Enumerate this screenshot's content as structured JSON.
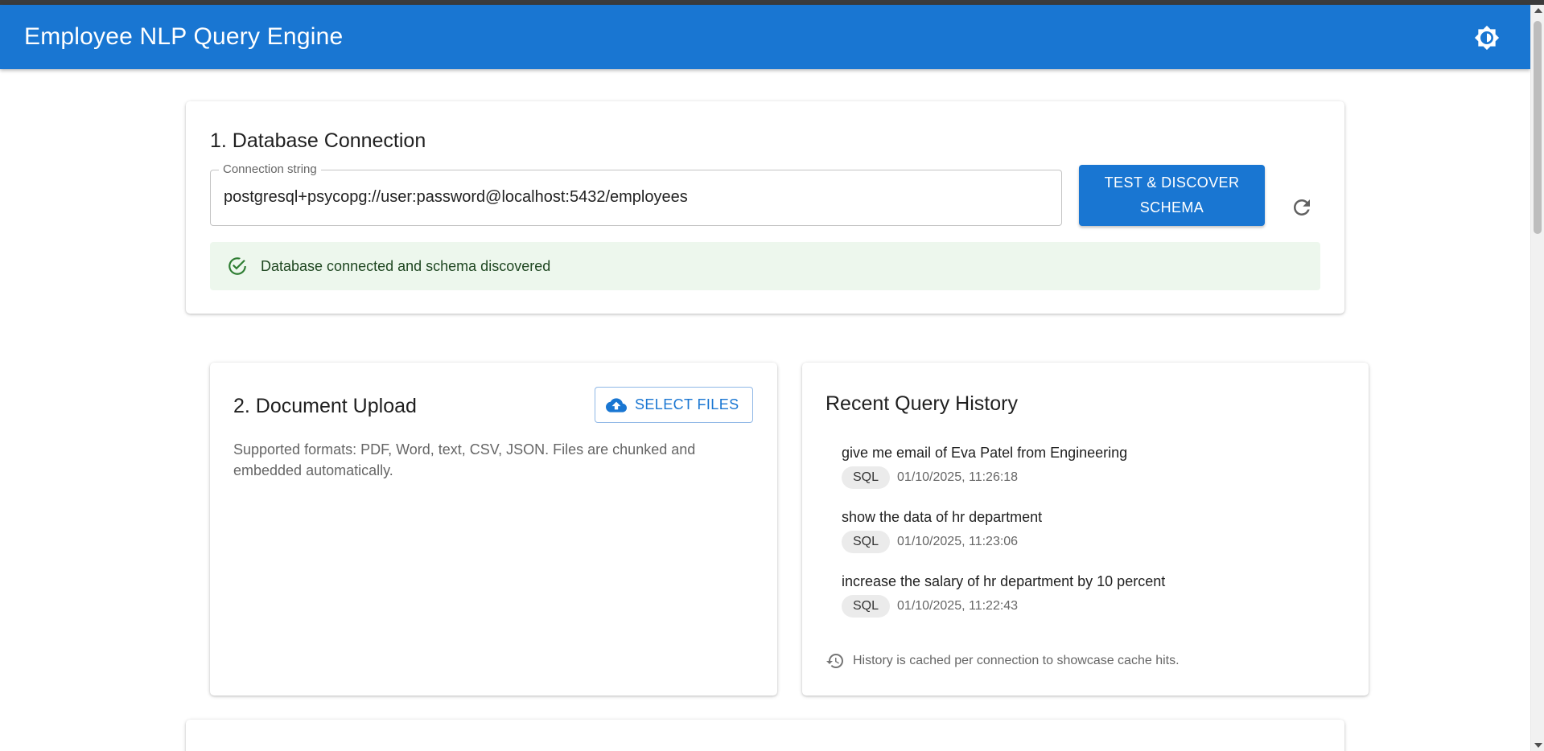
{
  "app": {
    "title": "Employee NLP Query Engine",
    "theme_icon": "brightness-icon"
  },
  "database": {
    "title": "1. Database Connection",
    "connection_label": "Connection string",
    "connection_value": "postgresql+psycopg://user:password@localhost:5432/employees",
    "test_button_line1": "TEST & DISCOVER",
    "test_button_line2": "SCHEMA",
    "refresh_icon": "refresh-icon",
    "status_text": "Database connected and schema discovered",
    "status_color": "#edf7ed"
  },
  "upload": {
    "title": "2. Document Upload",
    "select_label": "SELECT FILES",
    "description": "Supported formats: PDF, Word, text, CSV, JSON. Files are chunked and embedded automatically."
  },
  "history": {
    "title": "Recent Query History",
    "items": [
      {
        "query": "give me email of Eva Patel from Engineering",
        "type": "SQL",
        "time": "01/10/2025, 11:26:18"
      },
      {
        "query": "show the data of hr department",
        "type": "SQL",
        "time": "01/10/2025, 11:23:06"
      },
      {
        "query": "increase the salary of hr department by 10 percent",
        "type": "SQL",
        "time": "01/10/2025, 11:22:43"
      }
    ],
    "note": "History is cached per connection to showcase cache hits."
  },
  "colors": {
    "primary": "#1976d2",
    "success": "#2e7d32"
  }
}
